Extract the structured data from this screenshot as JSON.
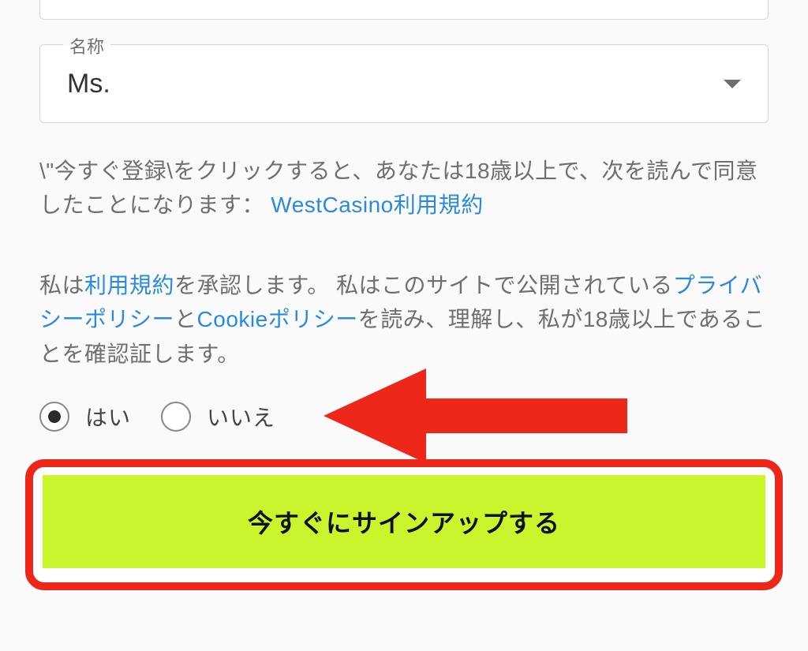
{
  "title_field": {
    "label": "名称",
    "value": "Ms."
  },
  "consent1": {
    "prefix": "\\\"今すぐ登録\\をクリックすると、あなたは18歳以上で、次を読んで同意したことになります： ",
    "link": "WestCasino利用規約"
  },
  "consent2": {
    "seg1": "私は",
    "link_terms": "利用規約",
    "seg2": "を承認します。 私はこのサイトで公開されている",
    "link_privacy": "プライバシーポリシー",
    "seg3": "と",
    "link_cookie": "Cookieポリシー",
    "seg4": "を読み、理解し、私が18歳以上であることを確認証します。"
  },
  "radios": {
    "yes": "はい",
    "no": "いいえ",
    "selected": "yes"
  },
  "signup_button": "今すぐにサインアップする",
  "annotation_arrow_color": "#ee271b"
}
